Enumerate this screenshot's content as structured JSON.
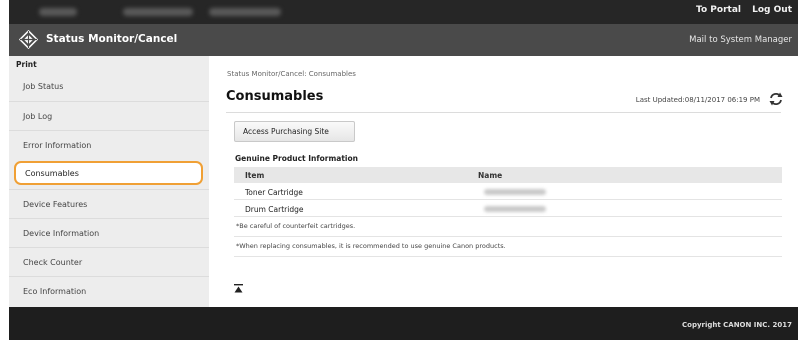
{
  "topbar": {
    "portal_label": "To Portal",
    "logout_label": "Log Out"
  },
  "titlebar": {
    "title": "Status Monitor/Cancel",
    "mail_label": "Mail to System Manager",
    "logo_icon": "canon-diamond-icon"
  },
  "sidebar": {
    "section_label": "Print",
    "items": [
      {
        "label": "Job Status"
      },
      {
        "label": "Job Log"
      },
      {
        "label": "Error Information"
      },
      {
        "label": "Consumables"
      },
      {
        "label": "Device Features"
      },
      {
        "label": "Device Information"
      },
      {
        "label": "Check Counter"
      },
      {
        "label": "Eco Information"
      }
    ],
    "active_index": 3,
    "highlight_color": "#f0a035"
  },
  "main": {
    "breadcrumb": "Status Monitor/Cancel: Consumables",
    "title": "Consumables",
    "last_updated": "Last Updated:08/11/2017 06:19 PM",
    "refresh_icon": "refresh-icon",
    "purchase_button": "Access Purchasing Site",
    "section_title": "Genuine Product Information",
    "table": {
      "headers": [
        "Item",
        "Name"
      ],
      "rows": [
        {
          "item": "Toner Cartridge"
        },
        {
          "item": "Drum Cartridge"
        }
      ]
    },
    "notes": [
      "*Be careful of counterfeit cartridges.",
      "*When replacing consumables, it is recommended to use genuine Canon products."
    ],
    "to_top_icon": "to-top-icon"
  },
  "footer": {
    "copyright": "Copyright CANON INC. 2017"
  }
}
